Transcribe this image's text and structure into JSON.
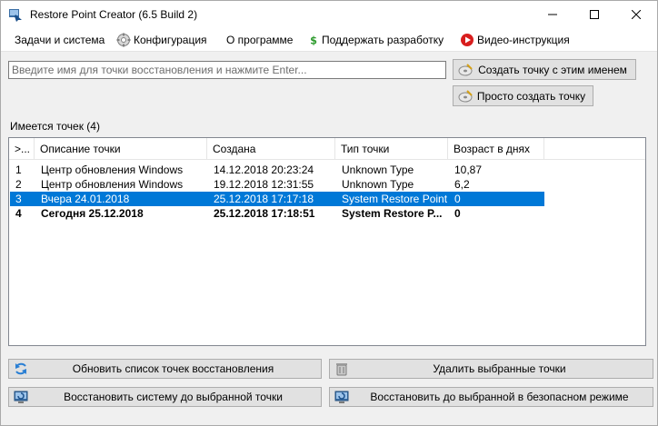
{
  "window": {
    "title": "Restore Point Creator (6.5 Build 2)"
  },
  "menu": [
    {
      "label": "Задачи и система",
      "icon": "none"
    },
    {
      "label": "Конфигурация",
      "icon": "gear-icon"
    },
    {
      "label": "О программе",
      "icon": "none"
    },
    {
      "label": "Поддержать разработку",
      "icon": "dollar-icon"
    },
    {
      "label": "Видео-инструкция",
      "icon": "play-icon"
    }
  ],
  "name_input": {
    "value": "",
    "placeholder": "Введите имя для точки восстановления и нажмите Enter..."
  },
  "buttons": {
    "create_named": "Создать точку с этим именем",
    "create_quick": "Просто создать точку",
    "refresh": "Обновить список точек восстановления",
    "delete": "Удалить выбранные точки",
    "restore": "Восстановить систему до выбранной точки",
    "restore_safe": "Восстановить до выбранной в безопасном режиме"
  },
  "points_count_label": "Имеется точек (4)",
  "list": {
    "columns": [
      ">...",
      "Описание точки",
      "Создана",
      "Тип точки",
      "Возраст в днях"
    ],
    "rows": [
      {
        "id": "1",
        "description": "Центр обновления Windows",
        "created": "14.12.2018 20:23:24",
        "type": "Unknown Type",
        "age": "10,87",
        "selected": false,
        "bold": false
      },
      {
        "id": "2",
        "description": "Центр обновления Windows",
        "created": "19.12.2018 12:31:55",
        "type": "Unknown Type",
        "age": "6,2",
        "selected": false,
        "bold": false
      },
      {
        "id": "3",
        "description": "Вчера 24.01.2018",
        "created": "25.12.2018 17:17:18",
        "type": "System Restore Point",
        "age": "0",
        "selected": true,
        "bold": false
      },
      {
        "id": "4",
        "description": "Сегодня 25.12.2018",
        "created": "25.12.2018 17:18:51",
        "type": "System Restore P...",
        "age": "0",
        "selected": false,
        "bold": true
      }
    ]
  },
  "colors": {
    "selection": "#0078d7",
    "button_face": "#e1e1e1",
    "window_bg": "#f0f0f0"
  }
}
